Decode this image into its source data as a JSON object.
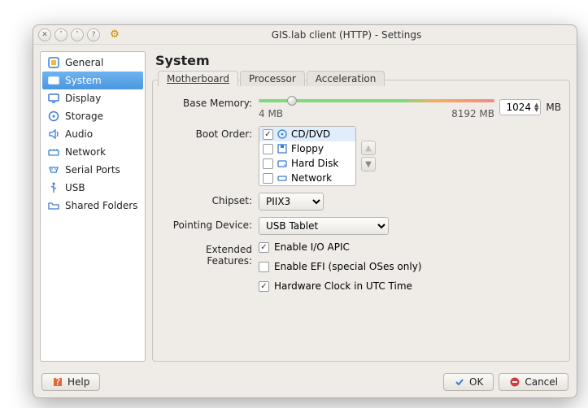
{
  "window": {
    "title": "GIS.lab client (HTTP) - Settings"
  },
  "sidebar": {
    "items": [
      {
        "label": "General"
      },
      {
        "label": "System"
      },
      {
        "label": "Display"
      },
      {
        "label": "Storage"
      },
      {
        "label": "Audio"
      },
      {
        "label": "Network"
      },
      {
        "label": "Serial Ports"
      },
      {
        "label": "USB"
      },
      {
        "label": "Shared Folders"
      }
    ]
  },
  "page": {
    "title": "System"
  },
  "tabs": {
    "motherboard": "Motherboard",
    "processor": "Processor",
    "acceleration": "Acceleration"
  },
  "memory": {
    "label": "Base Memory:",
    "value": "1024",
    "unit": "MB",
    "min_label": "4 MB",
    "max_label": "8192 MB"
  },
  "boot": {
    "label": "Boot Order:",
    "items": [
      {
        "name": "CD/DVD",
        "checked": true
      },
      {
        "name": "Floppy",
        "checked": false
      },
      {
        "name": "Hard Disk",
        "checked": false
      },
      {
        "name": "Network",
        "checked": false
      }
    ]
  },
  "chipset": {
    "label": "Chipset:",
    "value": "PIIX3"
  },
  "pointing": {
    "label": "Pointing Device:",
    "value": "USB Tablet"
  },
  "extended": {
    "label": "Extended Features:",
    "opt1": "Enable I/O APIC",
    "opt2": "Enable EFI (special OSes only)",
    "opt3": "Hardware Clock in UTC Time"
  },
  "footer": {
    "help": "Help",
    "ok": "OK",
    "cancel": "Cancel"
  }
}
